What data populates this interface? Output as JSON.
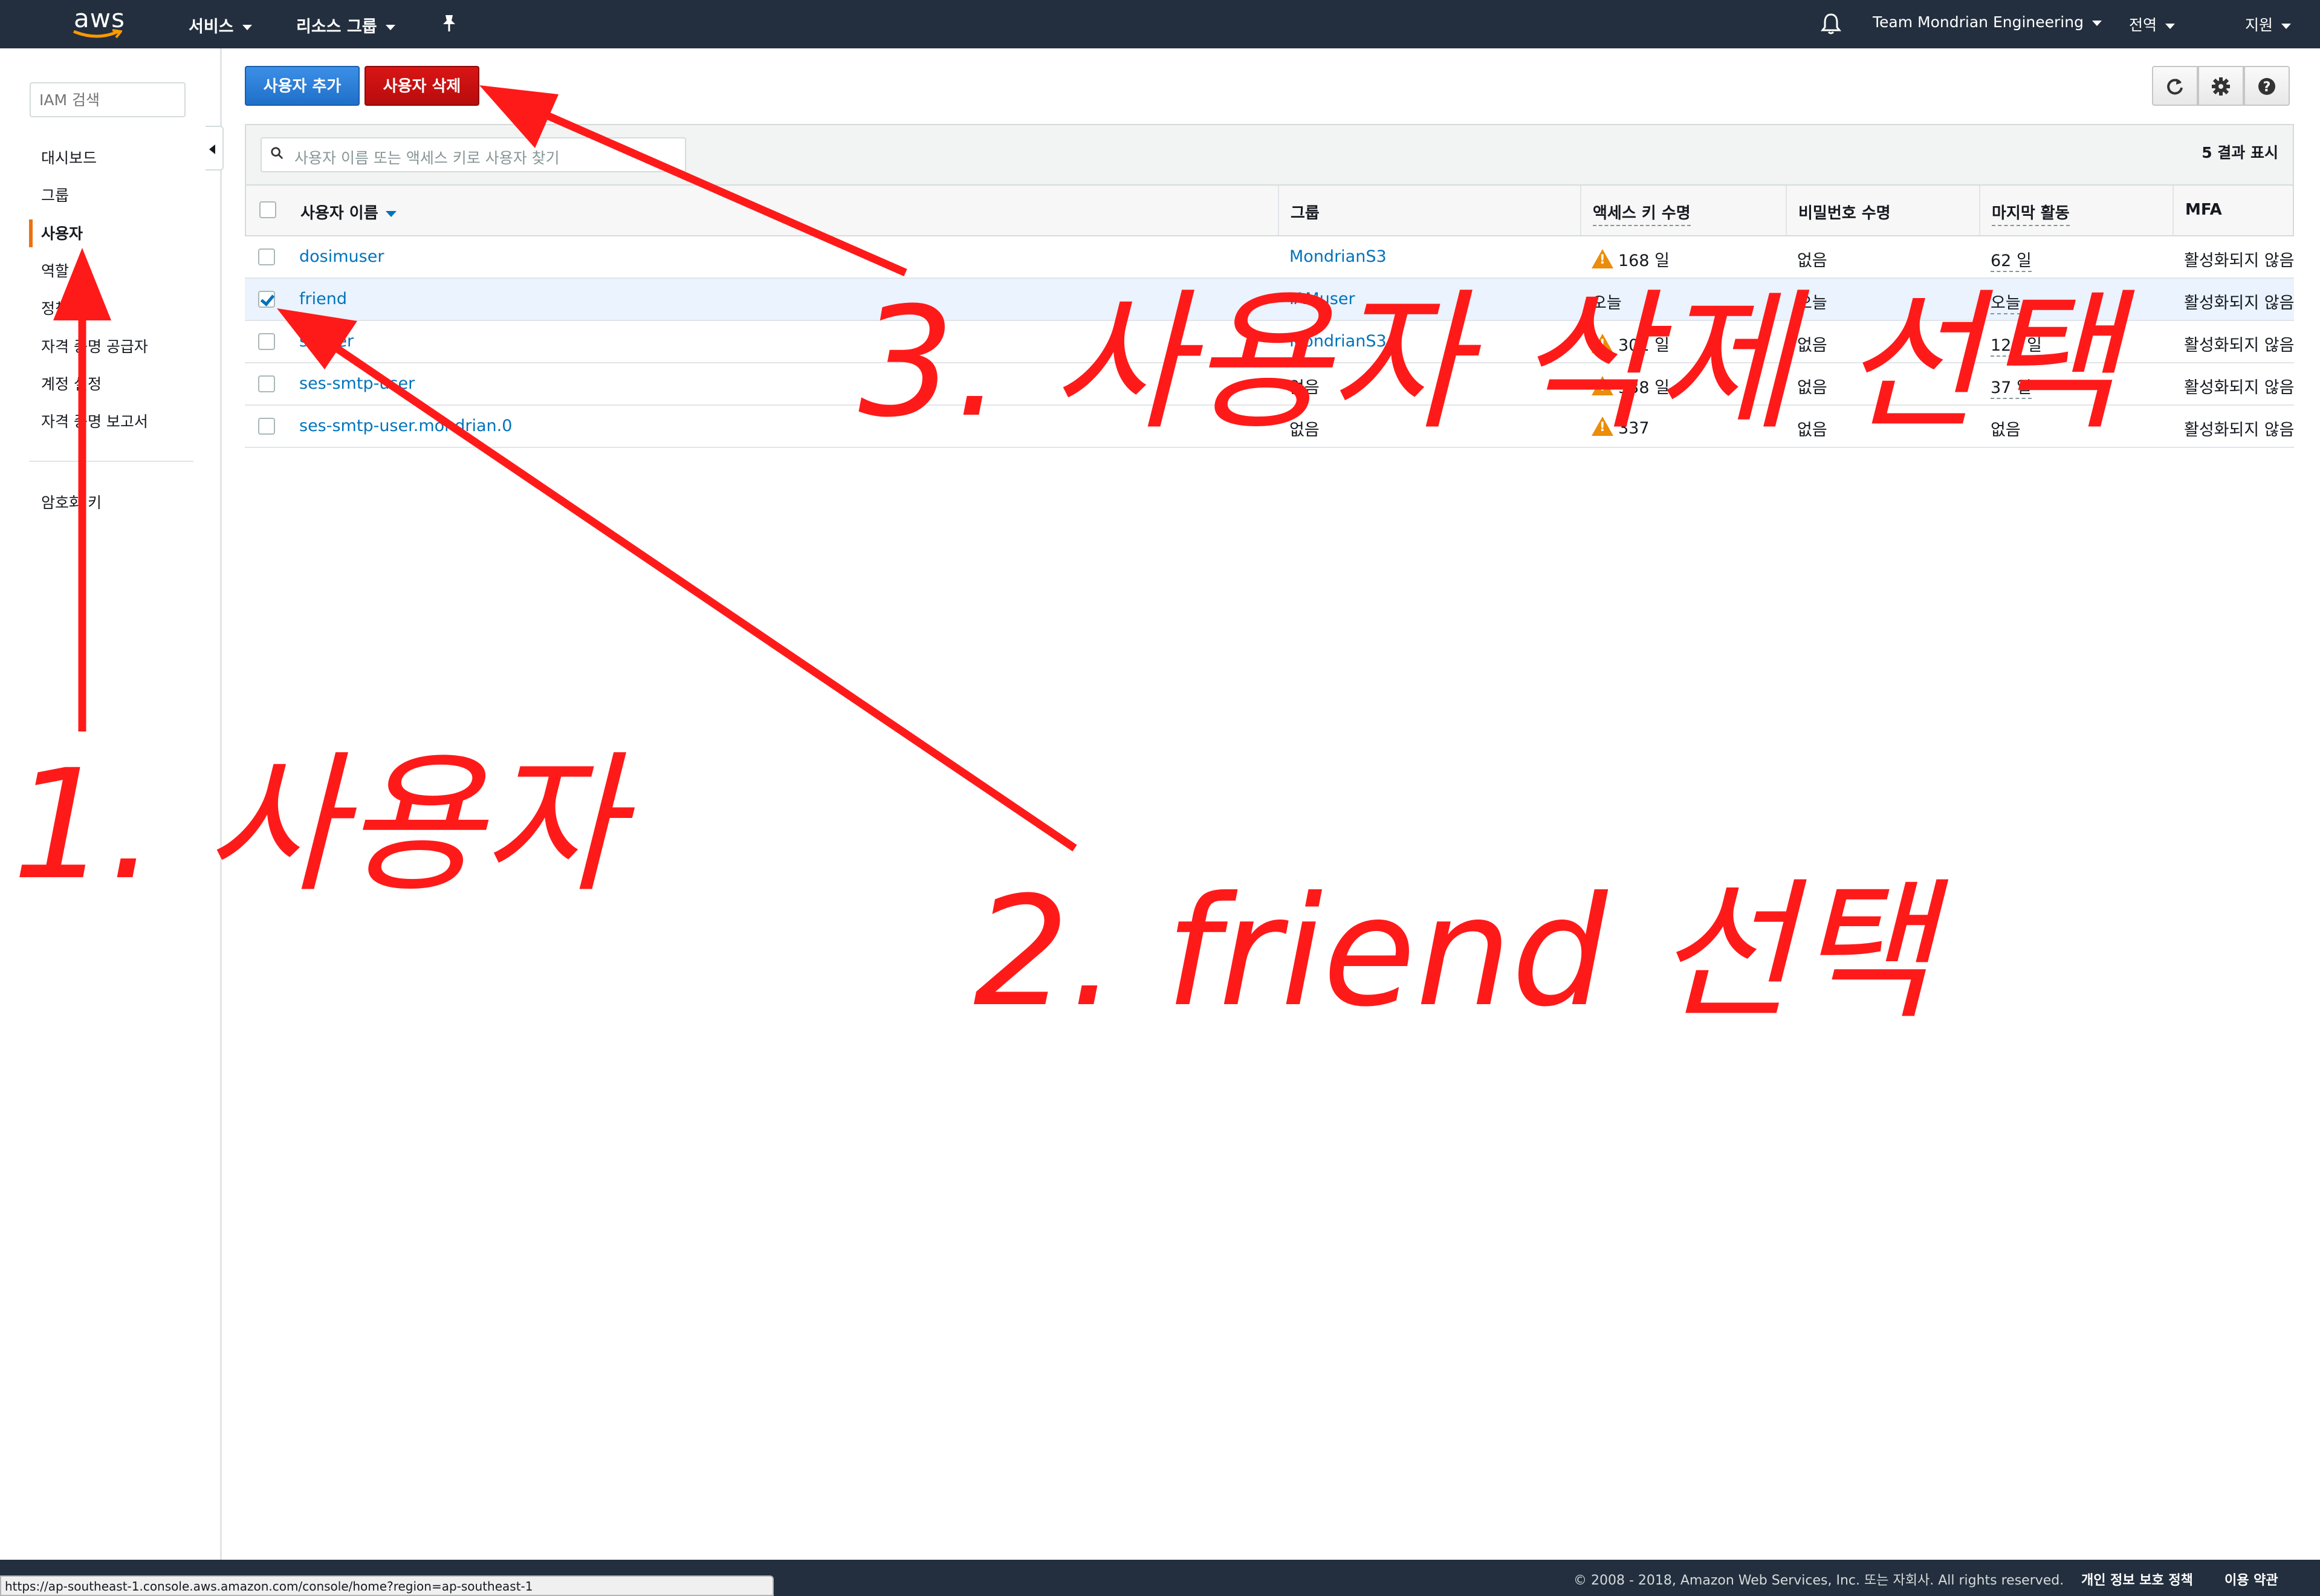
{
  "topbar": {
    "logo": "aws",
    "services": "서비스",
    "resource_groups": "리소스 그룹",
    "account": "Team Mondrian Engineering",
    "region": "전역",
    "support": "지원"
  },
  "sidebar": {
    "search_placeholder": "IAM 검색",
    "items": [
      {
        "label": "대시보드"
      },
      {
        "label": "그룹"
      },
      {
        "label": "사용자"
      },
      {
        "label": "역할"
      },
      {
        "label": "정책"
      },
      {
        "label": "자격 증명 공급자"
      },
      {
        "label": "계정 설정"
      },
      {
        "label": "자격 증명 보고서"
      }
    ],
    "encryption_keys": "암호화 키"
  },
  "toolbar": {
    "add_user": "사용자 추가",
    "delete_user": "사용자 삭제"
  },
  "table": {
    "search_placeholder": "사용자 이름 또는 액세스 키로 사용자 찾기",
    "result_count": "5 결과 표시",
    "headers": {
      "username": "사용자 이름",
      "groups": "그룹",
      "access_key_age": "액세스 키 수명",
      "password_age": "비밀번호 수명",
      "last_activity": "마지막 활동",
      "mfa": "MFA"
    },
    "rows": [
      {
        "username": "dosimuser",
        "groups": "MondrianS3",
        "access_key_age": "168 일",
        "password_age": "없음",
        "last_activity": "62 일",
        "mfa": "활성화되지 않음"
      },
      {
        "username": "friend",
        "groups": "IAMuser",
        "access_key_age": "오늘",
        "password_age": "오늘",
        "last_activity": "오늘",
        "mfa": "활성화되지 않음"
      },
      {
        "username": "s3user",
        "groups": "MondrianS3",
        "access_key_age": "301 일",
        "password_age": "없음",
        "last_activity": "120 일",
        "mfa": "활성화되지 않음"
      },
      {
        "username": "ses-smtp-user",
        "groups": "없음",
        "access_key_age": "338 일",
        "password_age": "없음",
        "last_activity": "37 일",
        "mfa": "활성화되지 않음"
      },
      {
        "username": "ses-smtp-user.mondrian.0",
        "groups": "없음",
        "access_key_age": "337",
        "password_age": "없음",
        "last_activity": "없음",
        "mfa": "활성화되지 않음"
      }
    ]
  },
  "footer": {
    "copyright": "© 2008 - 2018, Amazon Web Services, Inc. 또는 자회사. All rights reserved.",
    "privacy": "개인 정보 보호 정책",
    "terms": "이용 약관",
    "status_url": "https://ap-southeast-1.console.aws.amazon.com/console/home?region=ap-southeast-1"
  },
  "annotations": {
    "step1": "1. 사용자",
    "step2": "2. friend 선택",
    "step3": "3. 사용자 삭제 선택",
    "color": "#ff1a1a"
  }
}
